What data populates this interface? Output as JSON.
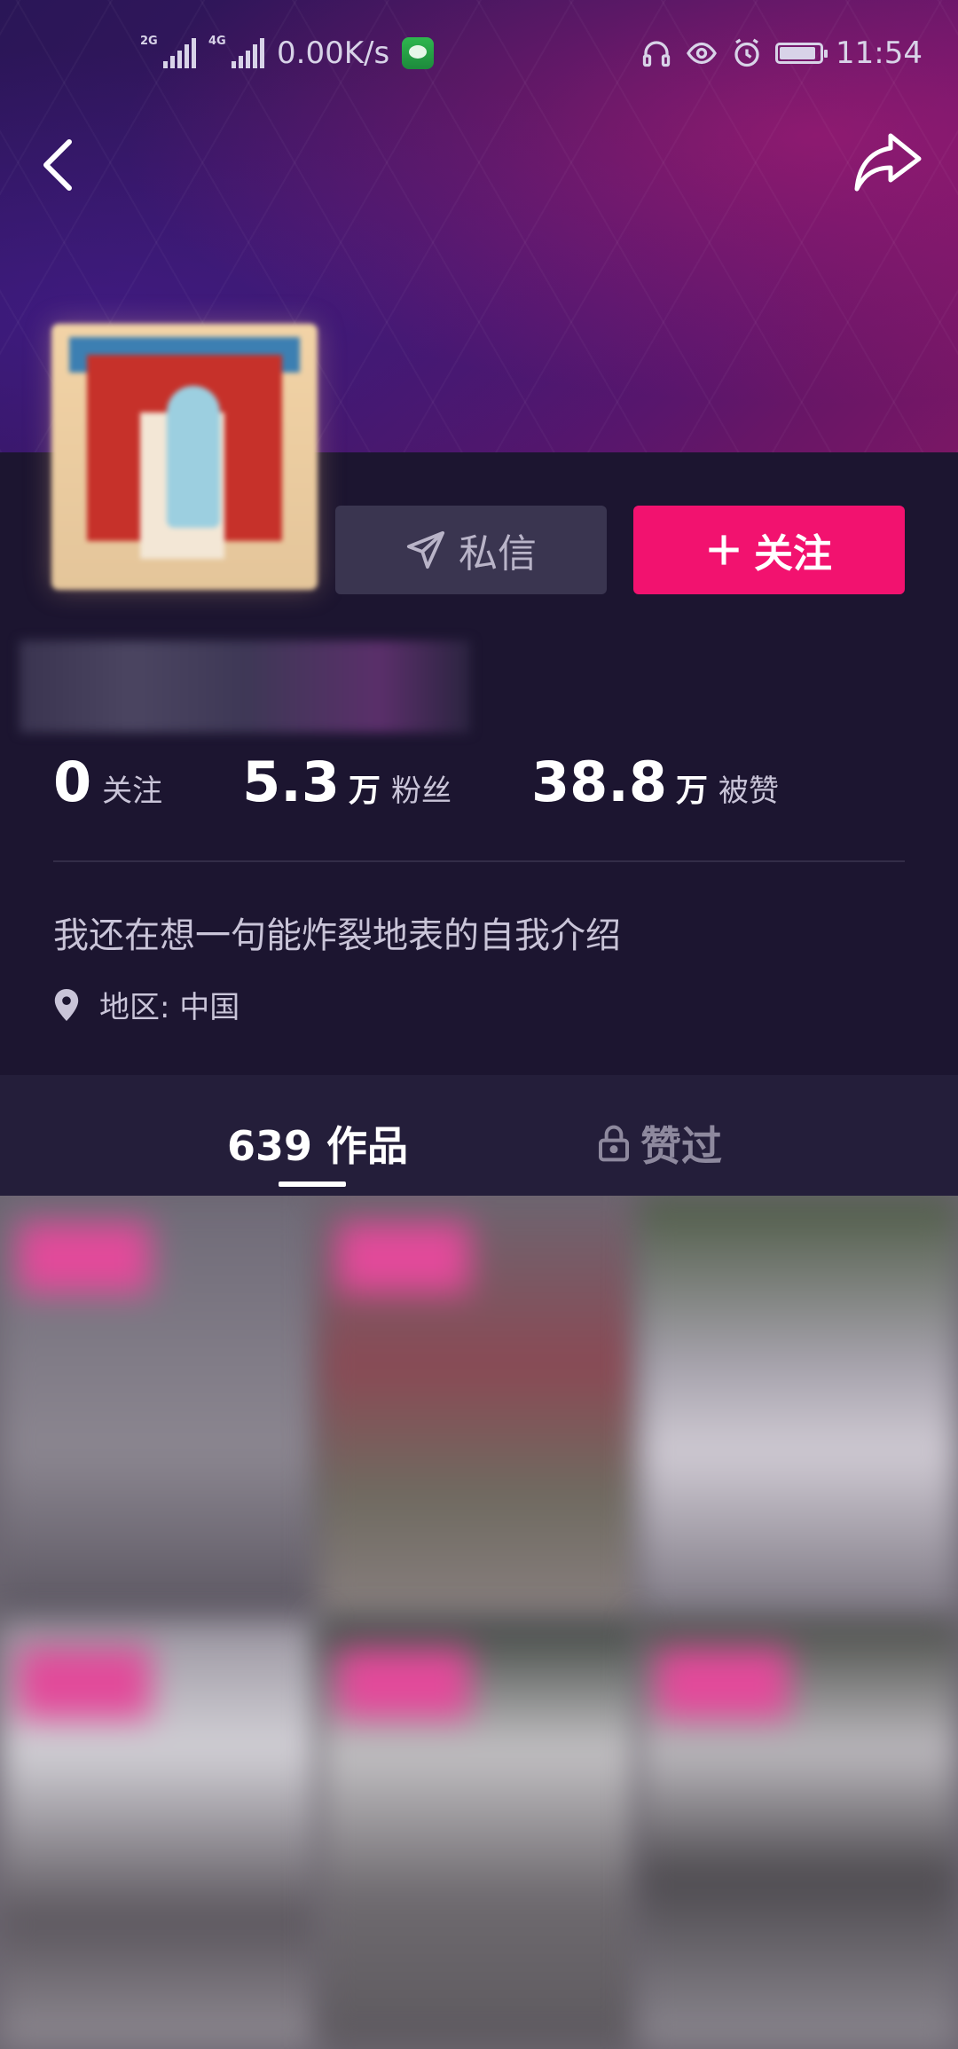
{
  "status_bar": {
    "signal_1": "2G",
    "signal_2": "4G",
    "net_speed": "0.00K/s",
    "time": "11:54",
    "icons": [
      "headphones-icon",
      "eye-icon",
      "alarm-icon",
      "battery-icon"
    ]
  },
  "header": {
    "back_icon": "chevron-left-icon",
    "share_icon": "share-arrow-icon"
  },
  "profile": {
    "actions": {
      "message_label": "私信",
      "follow_label": "关注"
    },
    "stats": {
      "following_count": "0",
      "following_label": "关注",
      "fans_count": "5.3",
      "fans_unit": "万",
      "fans_label": "粉丝",
      "likes_count": "38.8",
      "likes_unit": "万",
      "likes_label": "被赞"
    },
    "bio": "我还在想一句能炸裂地表的自我介绍",
    "region": "地区: 中国"
  },
  "tabs": {
    "works_label": "639 作品",
    "liked_label": "赞过"
  },
  "colors": {
    "background": "#1c1530",
    "follow_button": "#f2126f",
    "message_button": "#3a3550",
    "tab_bar": "#241e3a"
  }
}
